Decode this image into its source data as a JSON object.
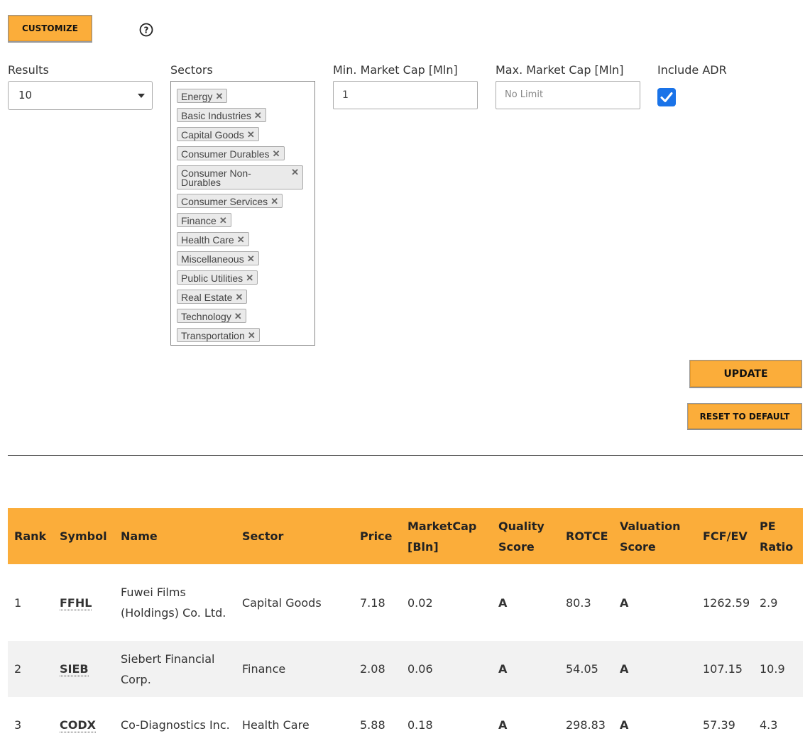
{
  "toolbar": {
    "customize_label": "CUSTOMIZE",
    "help_icon": "question-circle-icon"
  },
  "filters": {
    "results_label": "Results",
    "results_value": "10",
    "sectors_label": "Sectors",
    "sectors": [
      "Energy",
      "Basic Industries",
      "Capital Goods",
      "Consumer Durables",
      "Consumer Non-Durables",
      "Consumer Services",
      "Finance",
      "Health Care",
      "Miscellaneous",
      "Public Utilities",
      "Real Estate",
      "Technology",
      "Transportation"
    ],
    "min_cap_label": "Min. Market Cap [Mln]",
    "min_cap_value": "1",
    "max_cap_label": "Max. Market Cap [Mln]",
    "max_cap_placeholder": "No Limit",
    "adr_label": "Include ADR",
    "adr_checked": true
  },
  "actions": {
    "update_label": "UPDATE",
    "reset_label": "RESET TO DEFAULT"
  },
  "table": {
    "headers": [
      "Rank",
      "Symbol",
      "Name",
      "Sector",
      "Price",
      "MarketCap [Bln]",
      "Quality Score",
      "ROTCE",
      "Valuation Score",
      "FCF/EV",
      "PE Ratio"
    ],
    "rows": [
      [
        "1",
        "FFHL",
        "Fuwei Films (Holdings) Co. Ltd.",
        "Capital Goods",
        "7.18",
        "0.02",
        "A",
        "80.3",
        "A",
        "1262.59",
        "2.9"
      ],
      [
        "2",
        "SIEB",
        "Siebert Financial Corp.",
        "Finance",
        "2.08",
        "0.06",
        "A",
        "54.05",
        "A",
        "107.15",
        "10.9"
      ],
      [
        "3",
        "CODX",
        "Co-Diagnostics Inc.",
        "Health Care",
        "5.88",
        "0.18",
        "A",
        "298.83",
        "A",
        "57.39",
        "4.3"
      ]
    ]
  },
  "colors": {
    "accent": "#fbad3a",
    "checkbox": "#1a73e8"
  }
}
